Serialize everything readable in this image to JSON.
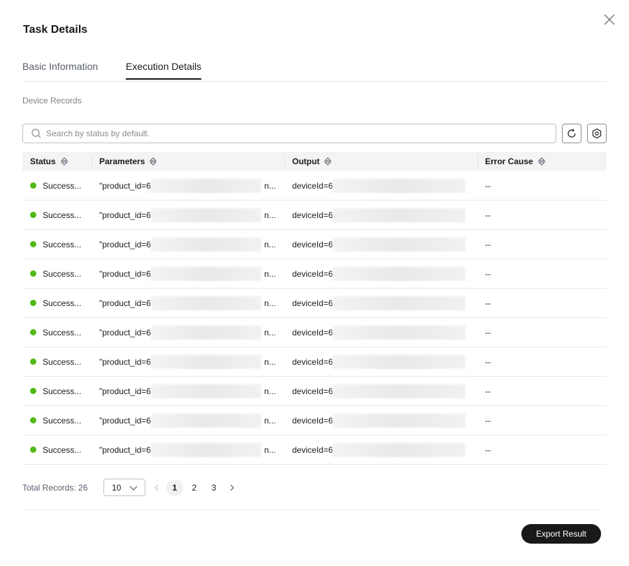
{
  "dialog": {
    "title": "Task Details"
  },
  "tabs": [
    {
      "label": "Basic Information",
      "active": false
    },
    {
      "label": "Execution Details",
      "active": true
    }
  ],
  "section": {
    "label": "Device Records"
  },
  "search": {
    "placeholder": "Search by status by default.",
    "value": ""
  },
  "table": {
    "columns": [
      {
        "label": "Status",
        "sortable": true
      },
      {
        "label": "Parameters",
        "sortable": true
      },
      {
        "label": "Output",
        "sortable": true
      },
      {
        "label": "Error Cause",
        "sortable": true
      }
    ],
    "rows": [
      {
        "status": "Success...",
        "param_prefix": "\"product_id=6",
        "param_suffix": "n...",
        "output_prefix": "deviceId=6",
        "output_suffix": "",
        "error": "--"
      },
      {
        "status": "Success...",
        "param_prefix": "\"product_id=6",
        "param_suffix": "n...",
        "output_prefix": "deviceId=6",
        "output_suffix": "",
        "error": "--"
      },
      {
        "status": "Success...",
        "param_prefix": "\"product_id=6",
        "param_suffix": "n...",
        "output_prefix": "deviceId=6",
        "output_suffix": "",
        "error": "--"
      },
      {
        "status": "Success...",
        "param_prefix": "\"product_id=6",
        "param_suffix": "n...",
        "output_prefix": "deviceId=6",
        "output_suffix": "",
        "error": "--"
      },
      {
        "status": "Success...",
        "param_prefix": "\"product_id=6",
        "param_suffix": "n...",
        "output_prefix": "deviceId=6",
        "output_suffix": "",
        "error": "--"
      },
      {
        "status": "Success...",
        "param_prefix": "\"product_id=6",
        "param_suffix": "n...",
        "output_prefix": "deviceId=6",
        "output_suffix": "",
        "error": "--"
      },
      {
        "status": "Success...",
        "param_prefix": "\"product_id=6",
        "param_suffix": "n...",
        "output_prefix": "deviceId=6",
        "output_suffix": "",
        "error": "--"
      },
      {
        "status": "Success...",
        "param_prefix": "\"product_id=6",
        "param_suffix": "n...",
        "output_prefix": "deviceId=6",
        "output_suffix": "",
        "error": "--"
      },
      {
        "status": "Success...",
        "param_prefix": "\"product_id=6",
        "param_suffix": "n...",
        "output_prefix": "deviceId=6",
        "output_suffix": "",
        "error": "--"
      },
      {
        "status": "Success...",
        "param_prefix": "\"product_id=6",
        "param_suffix": "n...",
        "output_prefix": "deviceId=6",
        "output_suffix": "",
        "error": "--"
      }
    ]
  },
  "pagination": {
    "total_label": "Total Records: 26",
    "page_size": "10",
    "pages": [
      "1",
      "2",
      "3"
    ],
    "current_page": "1"
  },
  "footer": {
    "export_label": "Export Result"
  },
  "colors": {
    "success_dot": "#52b818",
    "primary_button": "#191919",
    "header_bg": "#f4f4f4"
  },
  "icons": [
    "close-icon",
    "search-icon",
    "refresh-icon",
    "settings-icon",
    "sort-icon",
    "chevron-down-icon",
    "chevron-left-icon",
    "chevron-right-icon",
    "success-dot-icon"
  ]
}
